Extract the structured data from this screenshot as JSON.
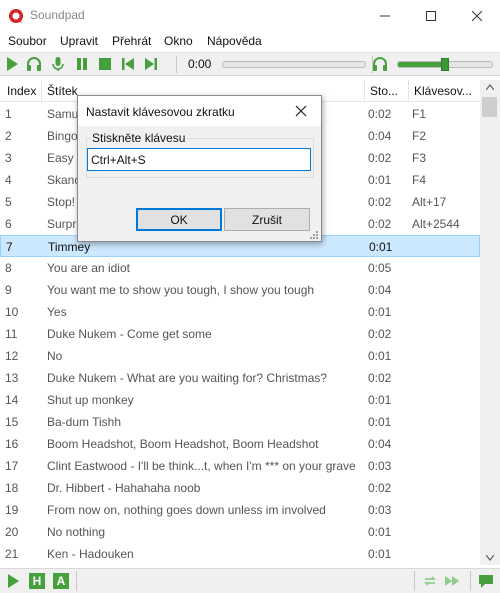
{
  "window": {
    "title": "Soundpad"
  },
  "menu": [
    "Soubor",
    "Upravit",
    "Přehrát",
    "Okno",
    "Nápověda"
  ],
  "toolbar": {
    "time": "0:00",
    "volume": 0.5
  },
  "columns": {
    "index": "Index",
    "label": "Štítek",
    "duration": "Sto...",
    "hotkey": "Klávesov..."
  },
  "rows": [
    {
      "index": "1",
      "label": "Samu",
      "duration": "0:02",
      "hotkey": "F1"
    },
    {
      "index": "2",
      "label": "Bingo",
      "duration": "0:04",
      "hotkey": "F2"
    },
    {
      "index": "3",
      "label": "Easy p",
      "duration": "0:02",
      "hotkey": "F3"
    },
    {
      "index": "4",
      "label": "Skano",
      "duration": "0:01",
      "hotkey": "F4"
    },
    {
      "index": "5",
      "label": "Stop!",
      "duration": "0:02",
      "hotkey": "Alt+17"
    },
    {
      "index": "6",
      "label": "Surpr",
      "duration": "0:02",
      "hotkey": "Alt+2544"
    },
    {
      "index": "7",
      "label": "Timmey",
      "duration": "0:01",
      "hotkey": ""
    },
    {
      "index": "8",
      "label": "You are an idiot",
      "duration": "0:05",
      "hotkey": ""
    },
    {
      "index": "9",
      "label": "You want me to show you tough, I show you tough",
      "duration": "0:04",
      "hotkey": ""
    },
    {
      "index": "10",
      "label": "Yes",
      "duration": "0:01",
      "hotkey": ""
    },
    {
      "index": "11",
      "label": "Duke Nukem - Come get some",
      "duration": "0:02",
      "hotkey": ""
    },
    {
      "index": "12",
      "label": "No",
      "duration": "0:01",
      "hotkey": ""
    },
    {
      "index": "13",
      "label": "Duke Nukem - What are you waiting for? Christmas?",
      "duration": "0:02",
      "hotkey": ""
    },
    {
      "index": "14",
      "label": "Shut up monkey",
      "duration": "0:01",
      "hotkey": ""
    },
    {
      "index": "15",
      "label": "Ba-dum Tishh",
      "duration": "0:01",
      "hotkey": ""
    },
    {
      "index": "16",
      "label": "Boom Headshot, Boom Headshot, Boom Headshot",
      "duration": "0:04",
      "hotkey": ""
    },
    {
      "index": "17",
      "label": "Clint Eastwood - I'll be think...t, when I'm *** on your grave",
      "duration": "0:03",
      "hotkey": ""
    },
    {
      "index": "18",
      "label": "Dr. Hibbert - Hahahaha noob",
      "duration": "0:02",
      "hotkey": ""
    },
    {
      "index": "19",
      "label": "From now on, nothing goes down unless im involved",
      "duration": "0:03",
      "hotkey": ""
    },
    {
      "index": "20",
      "label": "No nothing",
      "duration": "0:01",
      "hotkey": ""
    },
    {
      "index": "21",
      "label": "Ken - Hadouken",
      "duration": "0:01",
      "hotkey": ""
    }
  ],
  "selected_row": "7",
  "dialog": {
    "title": "Nastavit klávesovou zkratku",
    "group_label": "Stiskněte klávesu",
    "hotkey_value": "Ctrl+Alt+S",
    "ok_label": "OK",
    "cancel_label": "Zrušit"
  },
  "statusbar": {
    "h_label": "H",
    "a_label": "A"
  },
  "colors": {
    "accent_green": "#46a13d",
    "selection": "#cce8ff",
    "selection_border": "#99d1ff",
    "focus_blue": "#0078d7",
    "logo_red": "#d8232a"
  }
}
